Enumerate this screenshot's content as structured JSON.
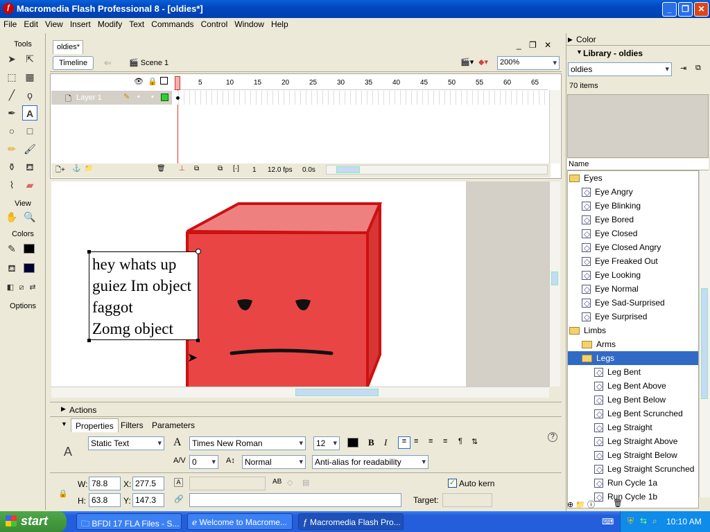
{
  "window": {
    "title": "Macromedia Flash Professional 8 - [oldies*]"
  },
  "menu": [
    "File",
    "Edit",
    "View",
    "Insert",
    "Modify",
    "Text",
    "Commands",
    "Control",
    "Window",
    "Help"
  ],
  "tools": {
    "header": "Tools",
    "view": "View",
    "colors": "Colors",
    "options": "Options"
  },
  "document": {
    "tab": "oldies*",
    "timeline_button": "Timeline",
    "scene": "Scene 1",
    "zoom": "200%"
  },
  "timeline": {
    "ruler": [
      "1",
      "5",
      "10",
      "15",
      "20",
      "25",
      "30",
      "35",
      "40",
      "45",
      "50",
      "55",
      "60",
      "65"
    ],
    "layer": "Layer 1",
    "frame": "1",
    "fps": "12.0 fps",
    "time": "0.0s"
  },
  "stage": {
    "text_lines": [
      "hey whats up",
      "guiez Im object",
      "faggot",
      "Zomg object"
    ]
  },
  "actions": {
    "label": "Actions"
  },
  "properties": {
    "tabs": [
      "Properties",
      "Filters",
      "Parameters"
    ],
    "text_type": "Static Text",
    "font": "Times New Roman",
    "size": "12",
    "letter_spacing": "0",
    "baseline": "Normal",
    "antialias": "Anti-alias for readability",
    "w_label": "W:",
    "w": "78.8",
    "x_label": "X:",
    "x": "277.5",
    "h_label": "H:",
    "h": "63.8",
    "y_label": "Y:",
    "y": "147.3",
    "auto_kern": "Auto kern",
    "target": "Target:",
    "bold": "B",
    "italic": "I",
    "text_color": "#000000"
  },
  "color_panel": {
    "label": "Color"
  },
  "library": {
    "title": "Library - oldies",
    "select": "oldies",
    "count": "70 items",
    "name_header": "Name",
    "items": [
      {
        "type": "folder",
        "label": "Eyes",
        "indent": 1
      },
      {
        "type": "symbol",
        "label": "Eye Angry",
        "indent": 2
      },
      {
        "type": "symbol",
        "label": "Eye Blinking",
        "indent": 2
      },
      {
        "type": "symbol",
        "label": "Eye Bored",
        "indent": 2
      },
      {
        "type": "symbol",
        "label": "Eye Closed",
        "indent": 2
      },
      {
        "type": "symbol",
        "label": "Eye Closed Angry",
        "indent": 2
      },
      {
        "type": "symbol",
        "label": "Eye Freaked Out",
        "indent": 2
      },
      {
        "type": "symbol",
        "label": "Eye Looking",
        "indent": 2
      },
      {
        "type": "symbol",
        "label": "Eye Normal",
        "indent": 2
      },
      {
        "type": "symbol",
        "label": "Eye Sad-Surprised",
        "indent": 2
      },
      {
        "type": "symbol",
        "label": "Eye Surprised",
        "indent": 2
      },
      {
        "type": "folder",
        "label": "Limbs",
        "indent": 1
      },
      {
        "type": "folder",
        "label": "Arms",
        "indent": 2
      },
      {
        "type": "folder",
        "label": "Legs",
        "indent": 2,
        "selected": true
      },
      {
        "type": "symbol",
        "label": "Leg Bent",
        "indent": 3
      },
      {
        "type": "symbol",
        "label": "Leg Bent Above",
        "indent": 3
      },
      {
        "type": "symbol",
        "label": "Leg Bent Below",
        "indent": 3
      },
      {
        "type": "symbol",
        "label": "Leg Bent Scrunched",
        "indent": 3
      },
      {
        "type": "symbol",
        "label": "Leg Straight",
        "indent": 3
      },
      {
        "type": "symbol",
        "label": "Leg Straight Above",
        "indent": 3
      },
      {
        "type": "symbol",
        "label": "Leg Straight Below",
        "indent": 3
      },
      {
        "type": "symbol",
        "label": "Leg Straight Scrunched",
        "indent": 3
      },
      {
        "type": "symbol",
        "label": "Run Cycle 1a",
        "indent": 3
      },
      {
        "type": "symbol",
        "label": "Run Cycle 1b",
        "indent": 3
      }
    ]
  },
  "taskbar": {
    "start": "start",
    "tasks": [
      "BFDI 17 FLA Files - S...",
      "Welcome to Macrome...",
      "Macromedia Flash Pro..."
    ],
    "clock": "10:10 AM"
  }
}
